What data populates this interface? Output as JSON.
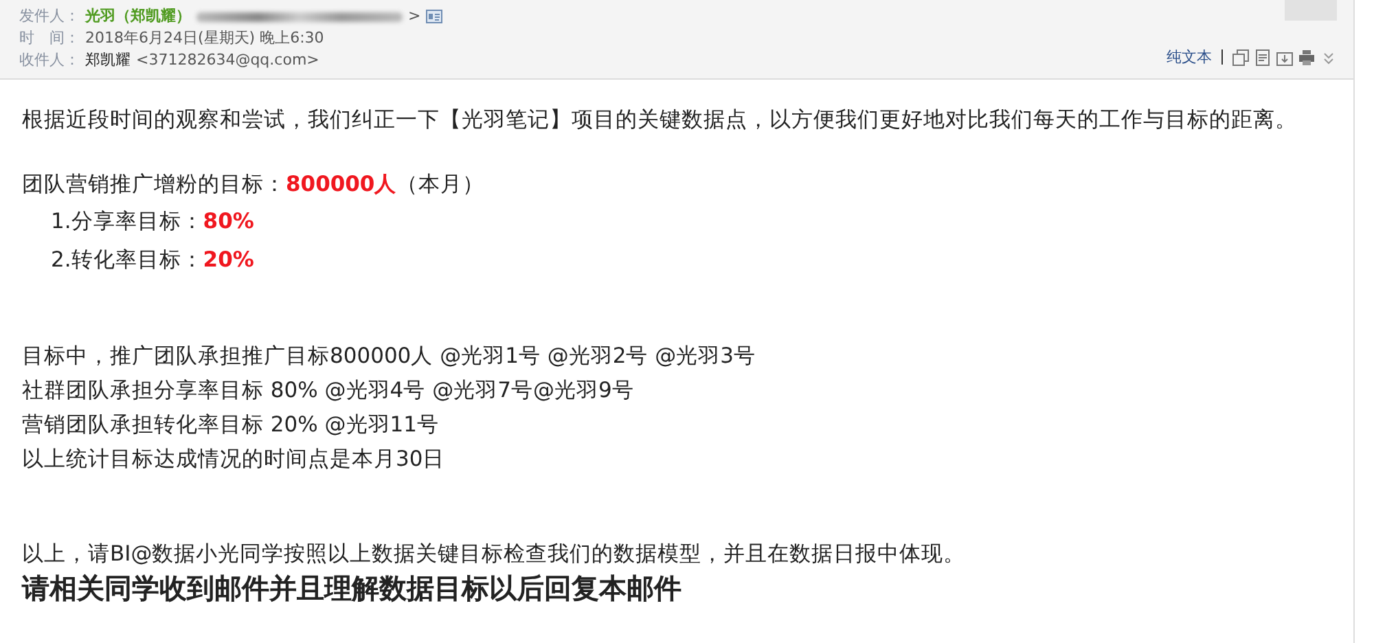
{
  "header": {
    "fields": [
      {
        "kind": "sender",
        "label": "发件人：",
        "name": "光羽（郑凯耀）",
        "address_end": ">"
      },
      {
        "kind": "time",
        "label": "时　间：",
        "value": "2018年6月24日(星期天) 晚上6:30"
      },
      {
        "kind": "recipient",
        "label": "收件人：",
        "name": "郑凯耀",
        "address": "<371282634@qq.com>"
      }
    ],
    "plain_text_link": "纯文本"
  },
  "body": {
    "paragraphs": [
      {
        "kind": "text",
        "text": "根据近段时间的观察和尝试，我们纠正一下【光羽笔记】项目的关键数据点，以方便我们更好地对比我们每天的工作与目标的距离。"
      },
      {
        "kind": "gap"
      },
      {
        "kind": "text",
        "text": "团队营销推广增粉的目标：**800000人**（本月）"
      },
      {
        "kind": "indent",
        "text": "1.分享率目标：**80%**"
      },
      {
        "kind": "indent",
        "text": "2.转化率目标：**20%**"
      },
      {
        "kind": "gap"
      },
      {
        "kind": "gap"
      },
      {
        "kind": "text",
        "text": "目标中，推广团队承担推广目标800000人 @光羽1号 @光羽2号 @光羽3号"
      },
      {
        "kind": "text",
        "text": "社群团队承担分享率目标 80%  @光羽4号 @光羽7号@光羽9号"
      },
      {
        "kind": "text",
        "text": "营销团队承担转化率目标 20%  @光羽11号"
      },
      {
        "kind": "text",
        "text": "以上统计目标达成情况的时间点是本月30日"
      },
      {
        "kind": "gap"
      },
      {
        "kind": "gap"
      },
      {
        "kind": "text",
        "text": "以上，请BI@数据小光同学按照以上数据关键目标检查我们的数据模型，并且在数据日报中体现。"
      },
      {
        "kind": "heading",
        "text": "请相关同学收到邮件并且理解数据目标以后回复本邮件"
      }
    ]
  }
}
